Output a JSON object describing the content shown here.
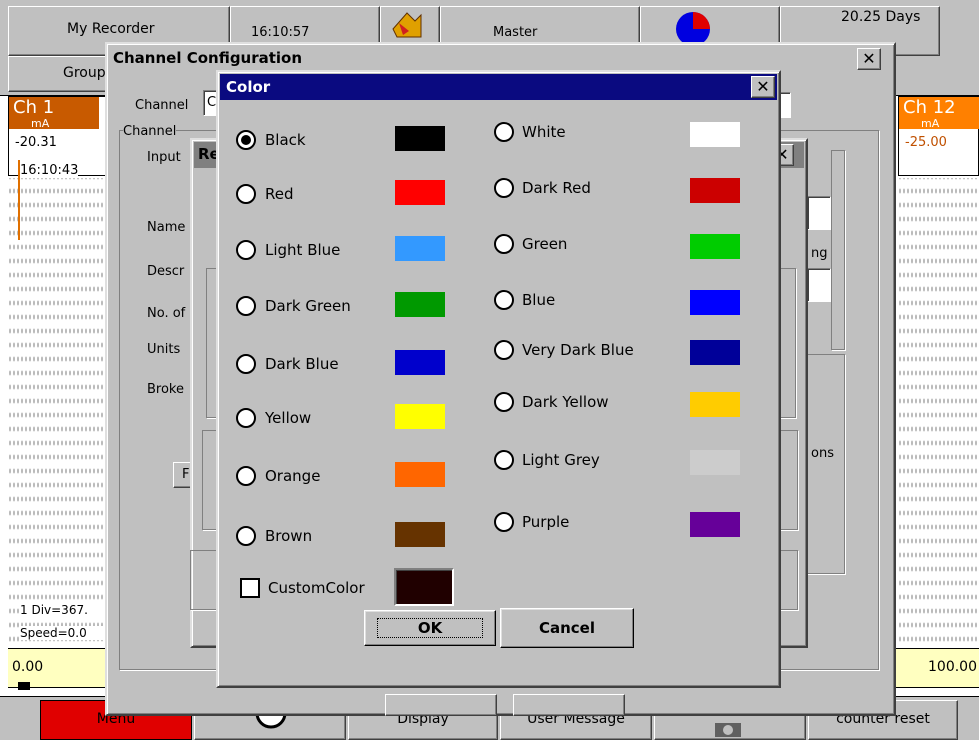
{
  "recorder": {
    "name": "My Recorder",
    "time": "16:10:57",
    "mode": "Master",
    "days": "20.25 Days",
    "group": "Group"
  },
  "channels": {
    "left": {
      "name": "Ch 1",
      "unit": "mA",
      "value": "-20.31",
      "color": "#d05800"
    },
    "right": {
      "name": "Ch 12",
      "unit": "mA",
      "value": "-25.00",
      "color": "#ff8000"
    }
  },
  "chart": {
    "timestamp": "16:10:43",
    "div_text": "1 Div=367.",
    "speed_text": "Speed=0.0",
    "scale_min": "0.00",
    "scale_max": "100.00"
  },
  "bottom_menu": {
    "menu": "Menu",
    "display": "Display",
    "user_message": "User Message",
    "counter_reset": "counter reset"
  },
  "channel_config": {
    "title": "Channel Configuration",
    "channel_label": "Channel",
    "channel_value": "C",
    "group_label": "Channel",
    "input_label": "Input",
    "name_label": "Name",
    "descr_label": "Descr",
    "no_label": "No. of",
    "units_label": "Units",
    "broken_label": "Broke",
    "f_button": "F",
    "c_label": "C",
    "ng_label": "ng",
    "ons_label": "ons"
  },
  "range_dialog": {
    "title": "Re"
  },
  "color_dialog": {
    "title": "Color",
    "colors_left": [
      {
        "label": "Black",
        "hex": "#000000",
        "selected": true
      },
      {
        "label": "Red",
        "hex": "#ff0000",
        "selected": false
      },
      {
        "label": "Light Blue",
        "hex": "#3399ff",
        "selected": false
      },
      {
        "label": "Dark Green",
        "hex": "#009900",
        "selected": false
      },
      {
        "label": "Dark Blue",
        "hex": "#0000cc",
        "selected": false
      },
      {
        "label": "Yellow",
        "hex": "#ffff00",
        "selected": false
      },
      {
        "label": "Orange",
        "hex": "#ff6600",
        "selected": false
      },
      {
        "label": "Brown",
        "hex": "#663300",
        "selected": false
      }
    ],
    "colors_right": [
      {
        "label": "White",
        "hex": "#ffffff",
        "selected": false
      },
      {
        "label": "Dark Red",
        "hex": "#cc0000",
        "selected": false
      },
      {
        "label": "Green",
        "hex": "#00cc00",
        "selected": false
      },
      {
        "label": "Blue",
        "hex": "#0000ff",
        "selected": false
      },
      {
        "label": "Very Dark Blue",
        "hex": "#000099",
        "selected": false
      },
      {
        "label": "Dark Yellow",
        "hex": "#ffcc00",
        "selected": false
      },
      {
        "label": "Light Grey",
        "hex": "#cccccc",
        "selected": false
      },
      {
        "label": "Purple",
        "hex": "#660099",
        "selected": false
      }
    ],
    "custom_color_label": "CustomColor",
    "custom_color_checked": false,
    "custom_color_hex": "#200000",
    "ok": "OK",
    "cancel": "Cancel"
  }
}
